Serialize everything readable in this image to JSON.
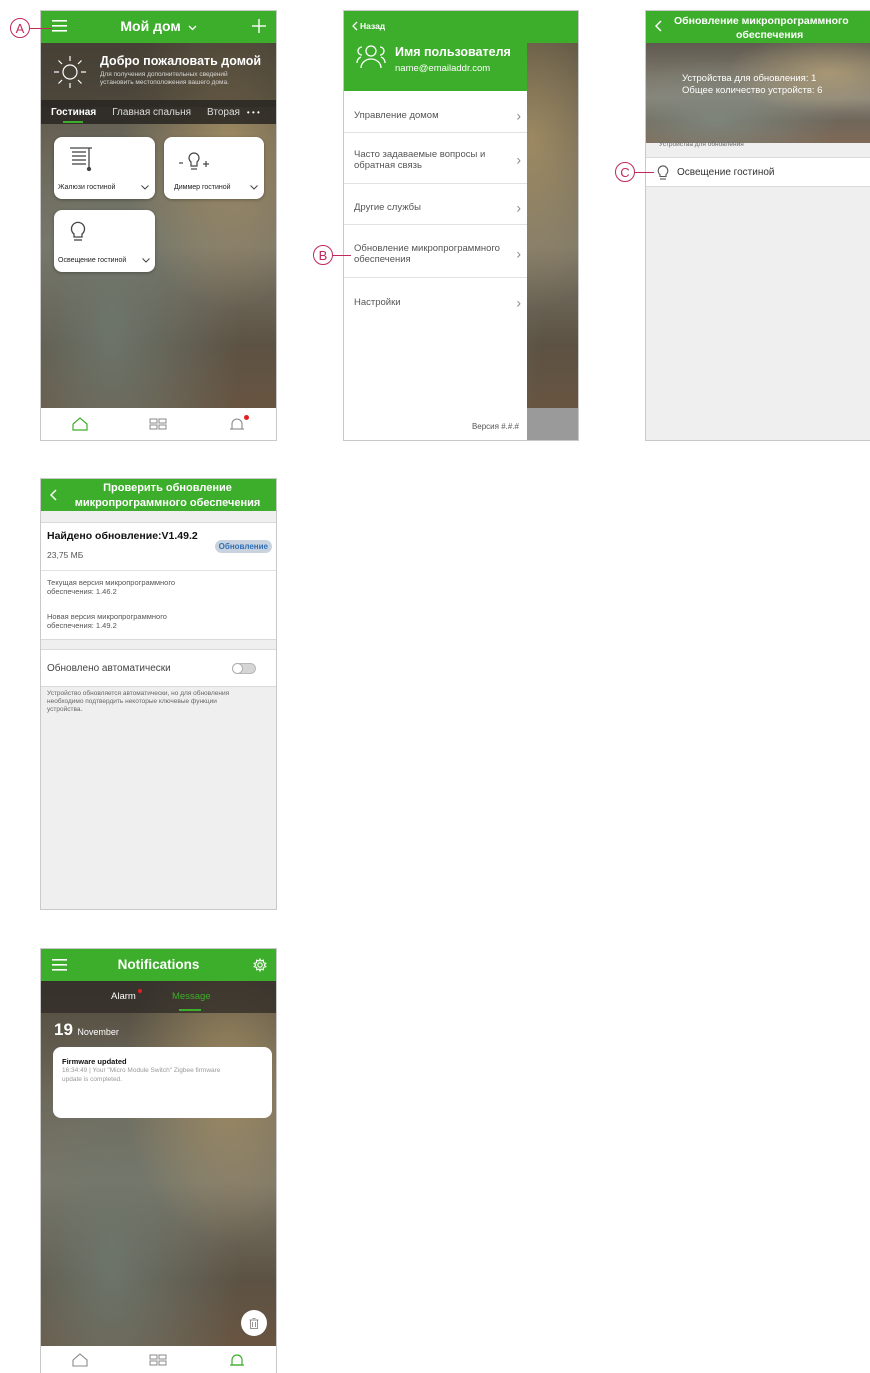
{
  "colors": {
    "brand_green": "#3dae2b",
    "callout": "#c0295a",
    "badge_blue": "#2f6fb5",
    "alert_red": "#e02020"
  },
  "callouts": {
    "a": "A",
    "b": "B",
    "c": "C"
  },
  "home": {
    "title": "Мой дом",
    "welcome_title": "Добро пожаловать домой",
    "welcome_sub_1": "Для получения дополнительных сведений",
    "welcome_sub_2": "установить местоположения вашего дома.",
    "tabs": [
      "Гостиная",
      "Главная спальня",
      "Вторая"
    ],
    "more": "• • •",
    "tiles": [
      "Жалюзи гостиной",
      "Диммер гостиной",
      "Освещение гостиной"
    ]
  },
  "menu": {
    "back": "Назад",
    "user_name": "Имя пользователя",
    "email": "name@emailaddr.com",
    "items": [
      [
        "Управление домом"
      ],
      [
        "Часто задаваемые вопросы и",
        "обратная связь"
      ],
      [
        "Другие службы"
      ],
      [
        "Обновление микропрограммного",
        "обеспечения"
      ],
      [
        "Настройки"
      ]
    ],
    "version": "Версия #.#.#"
  },
  "fw_list": {
    "title_1": "Обновление микропрограммного",
    "title_2": "обеспечения",
    "stat_1": "Устройства для обновления: 1",
    "stat_2": "Общее количество устройств: 6",
    "section": "Устройства для обновления",
    "device": "Освещение гостиной"
  },
  "fw_check": {
    "title_1": "Проверить обновление",
    "title_2": "микропрограммного обеспечения",
    "found": "Найдено обновление:V1.49.2",
    "size": "23,75 МБ",
    "update_btn": "Обновление",
    "current_1": "Текущая версия микропрограммного",
    "current_2": "обеспечения: 1.46.2",
    "new_1": "Новая версия микропрограммного",
    "new_2": "обеспечения: 1.49.2",
    "auto_label": "Обновлено автоматически",
    "auto_enabled": false,
    "note_1": "Устройство обновляется автоматически, но для обновления",
    "note_2": "необходимо подтвердить некоторые ключевые функции",
    "note_3": "устройства."
  },
  "notifications": {
    "title": "Notifications",
    "tab_alarm": "Alarm",
    "tab_message": "Message",
    "day": "19",
    "month": "November",
    "card_title": "Firmware updated",
    "card_line_1": "16:34:49 | Your \"Micro Module Switch\" Zigbee firmware",
    "card_line_2": "update is completed."
  }
}
